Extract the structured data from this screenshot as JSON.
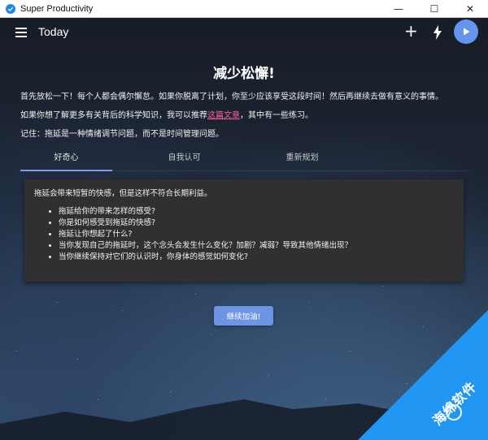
{
  "window": {
    "title": "Super Productivity",
    "minimize_glyph": "—",
    "maximize_glyph": "☐",
    "close_glyph": "✕"
  },
  "toolbar": {
    "title": "Today",
    "add_glyph": "+"
  },
  "content": {
    "heading": "减少松懈!",
    "para1": "首先放松一下！每个人都会偶尔懈怠。如果你脱离了计划，你至少应该享受这段时间！然后再继续去做有意义的事情。",
    "para2_before": "如果你想了解更多有关背后的科学知识，我可以推荐",
    "para2_link": "这篇文章",
    "para2_after": "，其中有一些练习。",
    "para3": "记住：拖延是一种情绪调节问题，而不是时间管理问题。"
  },
  "tabs": [
    {
      "label": "好奇心",
      "active": true
    },
    {
      "label": "自我认可",
      "active": false
    },
    {
      "label": "重新规划",
      "active": false
    }
  ],
  "card": {
    "intro": "拖延会带来短暂的快感，但是这样不符合长期利益。",
    "items": [
      "拖延给你的带来怎样的感受?",
      "你是如何感受到拖延的快感?",
      "拖延让你想起了什么?",
      "当你发现自己的拖延时，这个念头会发生什么变化？加剧？减弱？导致其他情绪出现？",
      "当你继续保持对它们的认识时，你身体的感觉如何变化?"
    ]
  },
  "continue_button": "继续加油!",
  "watermark": "海绵软件",
  "colors": {
    "accent": "#6495ed",
    "link": "#ff5c9d",
    "card_bg": "#303030",
    "watermark_blue": "#2196f3"
  }
}
